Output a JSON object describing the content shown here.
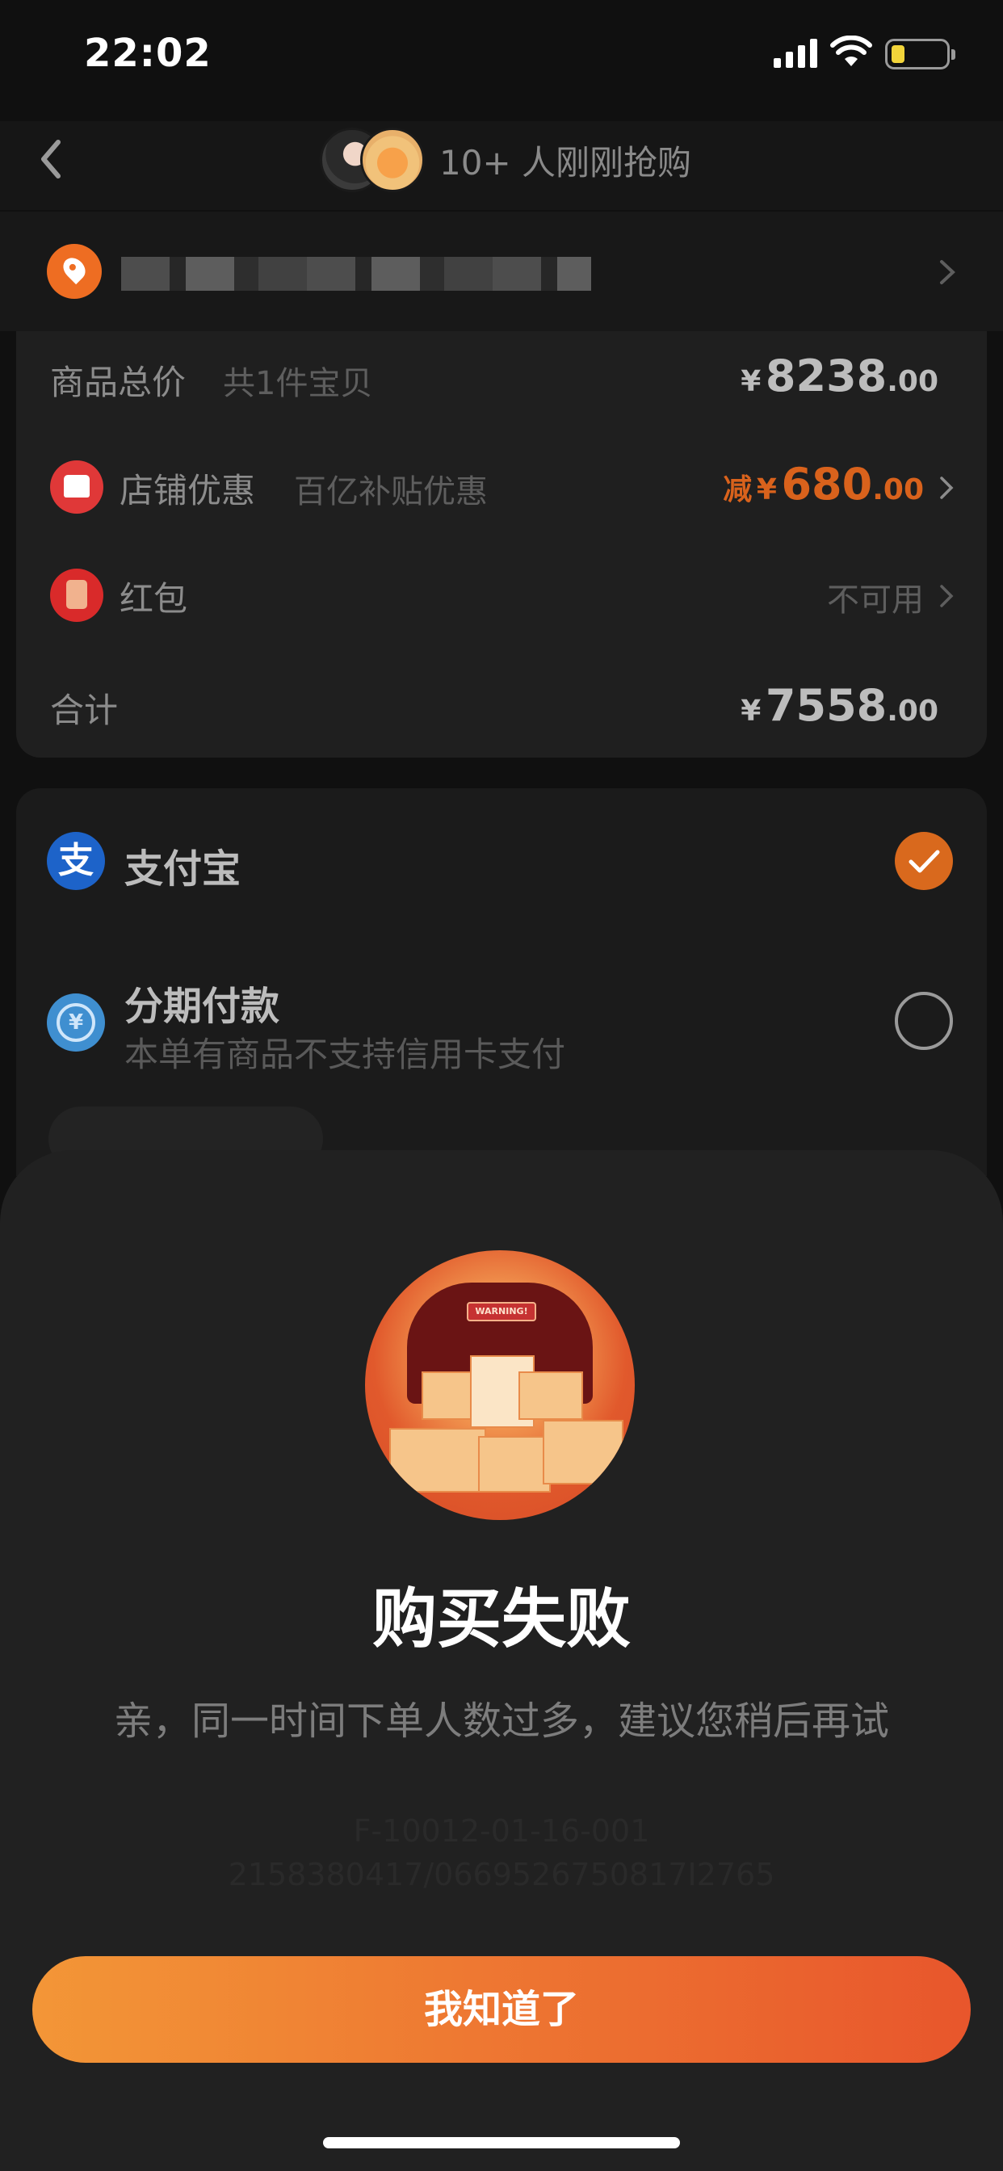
{
  "status_bar": {
    "time": "22:02"
  },
  "header": {
    "title": "10+ 人刚刚抢购"
  },
  "order_summary": {
    "total_label": "商品总价",
    "total_sub": "共1件宝贝",
    "total_yen": "¥",
    "total_int": "8238",
    "total_dec": ".00",
    "shop_discount_label": "店铺优惠",
    "shop_discount_sub": "百亿补贴优惠",
    "shop_discount_prefix": "减",
    "shop_discount_yen": "¥",
    "shop_discount_int": "680",
    "shop_discount_dec": ".00",
    "red_packet_label": "红包",
    "red_packet_value": "不可用",
    "sum_label": "合计",
    "sum_yen": "¥",
    "sum_int": "7558",
    "sum_dec": ".00"
  },
  "payment": {
    "alipay_label": "支付宝",
    "alipay_icon_glyph": "支",
    "installment_label": "分期付款",
    "installment_icon_glyph": "¥",
    "installment_sub": "本单有商品不支持信用卡支付"
  },
  "modal": {
    "illustration_sign": "WARNING!",
    "title": "购买失败",
    "message": "亲，同一时间下单人数过多，建议您稍后再试",
    "code_line_1": "F-10012-01-16-001",
    "code_line_2": "2158380417/0669526750817I2765",
    "button_label": "我知道了"
  },
  "colors": {
    "accent": "#e8562c",
    "accent_start": "#f39637",
    "alipay_blue": "#1d63c9",
    "discount_orange": "#d9621c"
  },
  "icons": {
    "back": "chevron-left-icon",
    "location": "location-pin-icon",
    "shop": "shop-icon",
    "red_packet": "red-packet-icon",
    "alipay": "alipay-icon",
    "installment": "installment-icon",
    "check": "check-icon"
  }
}
